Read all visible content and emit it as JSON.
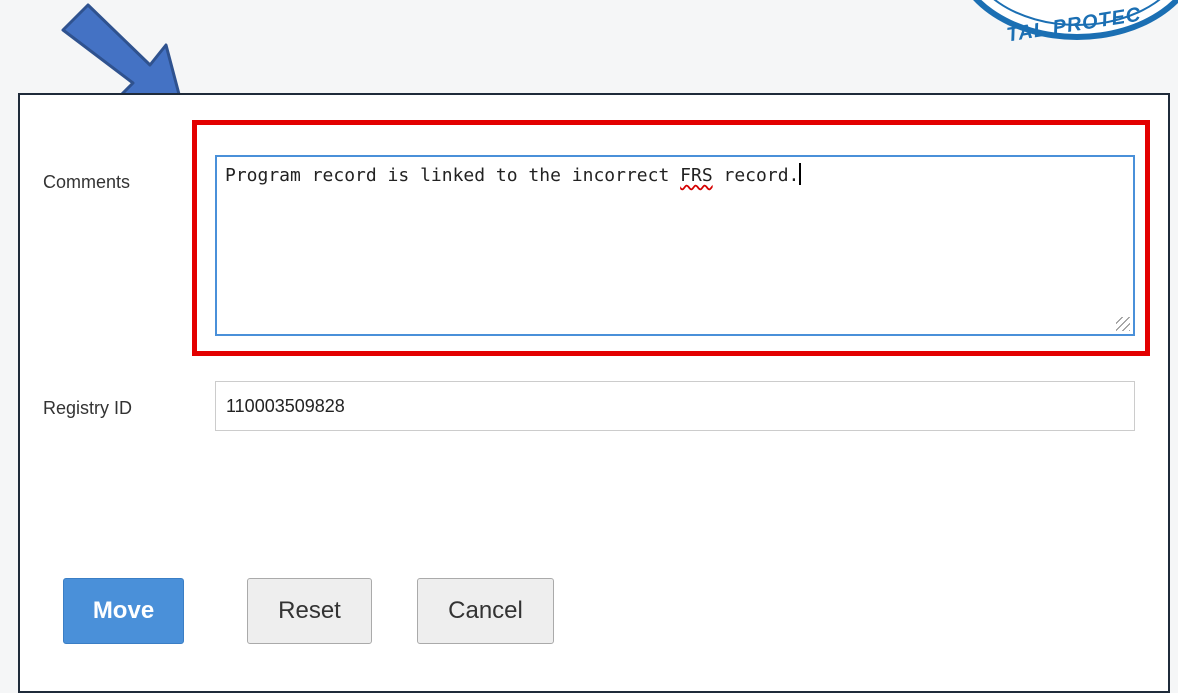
{
  "seal": {
    "text": "TAL PROTEC",
    "color": "#1b6fb3"
  },
  "form": {
    "comments_label": "Comments",
    "comments_value_before": "Program record is linked to the incorrect ",
    "comments_value_flagged": "FRS",
    "comments_value_after": " record.",
    "registry_label": "Registry ID",
    "registry_value": "110003509828"
  },
  "buttons": {
    "move": "Move",
    "reset": "Reset",
    "cancel": "Cancel"
  },
  "annotations": {
    "arrow_color": "#4472c4",
    "highlight_color": "#e30000"
  }
}
